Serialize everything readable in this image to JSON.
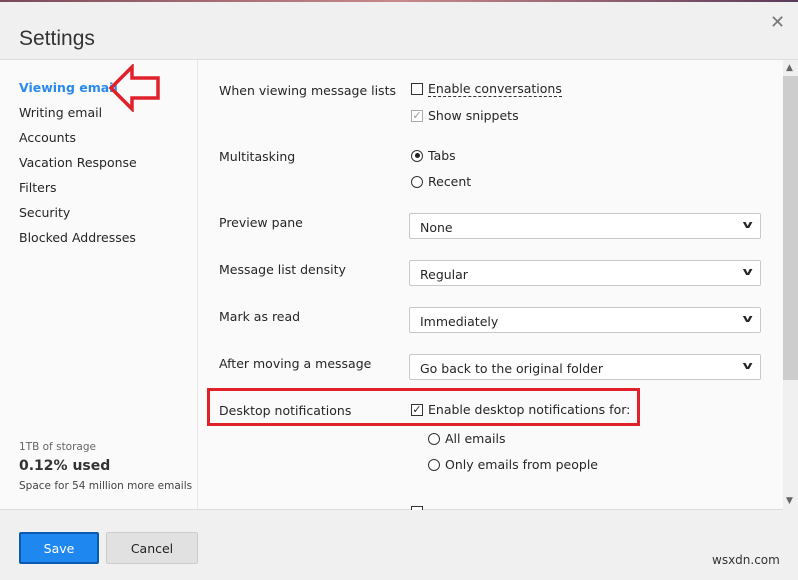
{
  "header": {
    "title": "Settings",
    "close_icon": "close-icon"
  },
  "sidebar": {
    "items": [
      {
        "label": "Viewing email",
        "active": true
      },
      {
        "label": "Writing email"
      },
      {
        "label": "Accounts"
      },
      {
        "label": "Vacation Response"
      },
      {
        "label": "Filters"
      },
      {
        "label": "Security"
      },
      {
        "label": "Blocked Addresses"
      }
    ],
    "storage": {
      "capacity": "1TB of storage",
      "used": "0.12% used",
      "space": "Space for 54 million more emails"
    }
  },
  "main": {
    "message_lists": {
      "label": "When viewing message lists",
      "enable_conversations": "Enable conversations",
      "enable_conversations_checked": false,
      "show_snippets": "Show snippets",
      "show_snippets_checked": true
    },
    "multitasking": {
      "label": "Multitasking",
      "options": [
        "Tabs",
        "Recent"
      ],
      "selected": "Tabs"
    },
    "preview_pane": {
      "label": "Preview pane",
      "value": "None"
    },
    "density": {
      "label": "Message list density",
      "value": "Regular"
    },
    "mark_read": {
      "label": "Mark as read",
      "value": "Immediately"
    },
    "after_move": {
      "label": "After moving a message",
      "value": "Go back to the original folder"
    },
    "desktop": {
      "label": "Desktop notifications",
      "enable": "Enable desktop notifications for:",
      "enable_checked": true,
      "options": [
        "All emails",
        "Only emails from people"
      ]
    }
  },
  "footer": {
    "save": "Save",
    "cancel": "Cancel"
  },
  "annotation_color": "#e0202a",
  "accent": "#1e88f0",
  "watermark": "wsxdn.com"
}
